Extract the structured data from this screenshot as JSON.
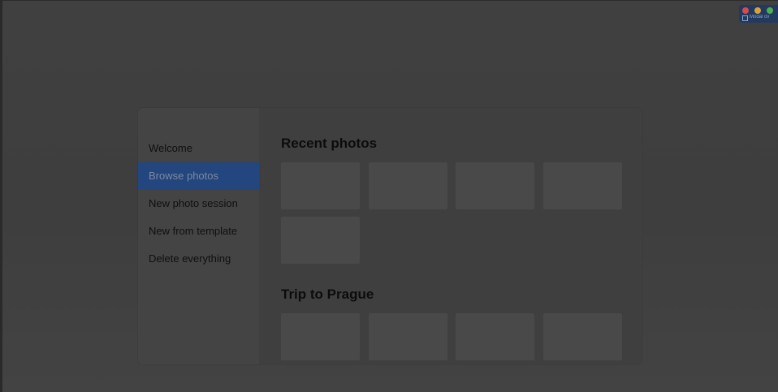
{
  "sidebar": {
    "items": [
      {
        "label": "Welcome",
        "active": false
      },
      {
        "label": "Browse photos",
        "active": true
      },
      {
        "label": "New photo session",
        "active": false
      },
      {
        "label": "New from template",
        "active": false
      },
      {
        "label": "Delete everything",
        "active": false
      }
    ]
  },
  "main": {
    "sections": [
      {
        "title": "Recent photos",
        "thumbnail_count": 5
      },
      {
        "title": "Trip to Prague",
        "thumbnail_count": 4
      }
    ]
  },
  "colors": {
    "accent": "#22467d",
    "overlay": "#3f3f3f",
    "thumbnail": "#494949"
  },
  "corner_widget": {
    "label": "Modal ov",
    "icons": [
      "close-dot-icon",
      "minimize-dot-icon",
      "maximize-dot-icon"
    ]
  }
}
